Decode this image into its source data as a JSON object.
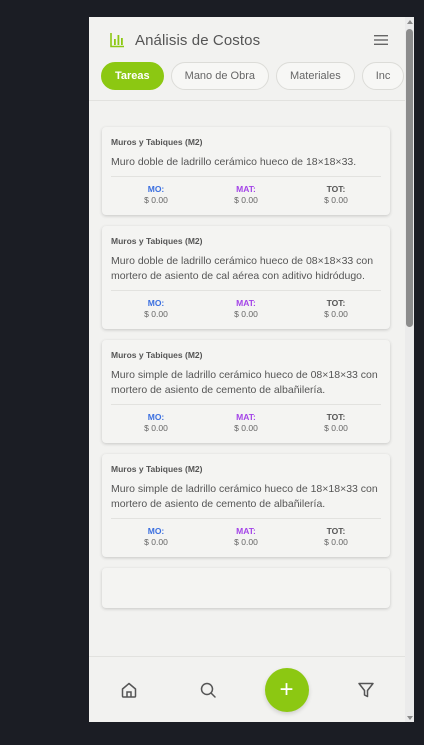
{
  "app": {
    "title": "Análisis de Costos",
    "accent_color": "#8cc812",
    "icons": {
      "logo": "bar-chart-icon",
      "menu": "hamburger-menu-icon"
    }
  },
  "tabs": [
    {
      "label": "Tareas",
      "active": true
    },
    {
      "label": "Mano de Obra",
      "active": false
    },
    {
      "label": "Materiales",
      "active": false
    },
    {
      "label": "Inc",
      "active": false
    }
  ],
  "cost_labels": {
    "mo": "MO:",
    "mat": "MAT:",
    "tot": "TOT:"
  },
  "cards": [
    {
      "category": "Muros y Tabiques (M2)",
      "description": "Muro doble de ladrillo cerámico hueco de 18×18×33.",
      "mo": "$ 0.00",
      "mat": "$ 0.00",
      "tot": "$ 0.00"
    },
    {
      "category": "Muros y Tabiques (M2)",
      "description": "Muro doble de ladrillo cerámico hueco de 08×18×33 con mortero de asiento de cal aérea con aditivo hidródugo.",
      "mo": "$ 0.00",
      "mat": "$ 0.00",
      "tot": "$ 0.00"
    },
    {
      "category": "Muros y Tabiques (M2)",
      "description": "Muro simple de ladrillo cerámico hueco de 08×18×33 con mortero de asiento de cemento de albañilería.",
      "mo": "$ 0.00",
      "mat": "$ 0.00",
      "tot": "$ 0.00"
    },
    {
      "category": "Muros y Tabiques (M2)",
      "description": "Muro simple de ladrillo cerámico hueco de 18×18×33 con mortero de asiento de cemento de albañilería.",
      "mo": "$ 0.00",
      "mat": "$ 0.00",
      "tot": "$ 0.00"
    }
  ],
  "bottom_nav": {
    "home_icon": "home-icon",
    "search_icon": "search-icon",
    "add_label": "+",
    "filter_icon": "filter-icon"
  }
}
